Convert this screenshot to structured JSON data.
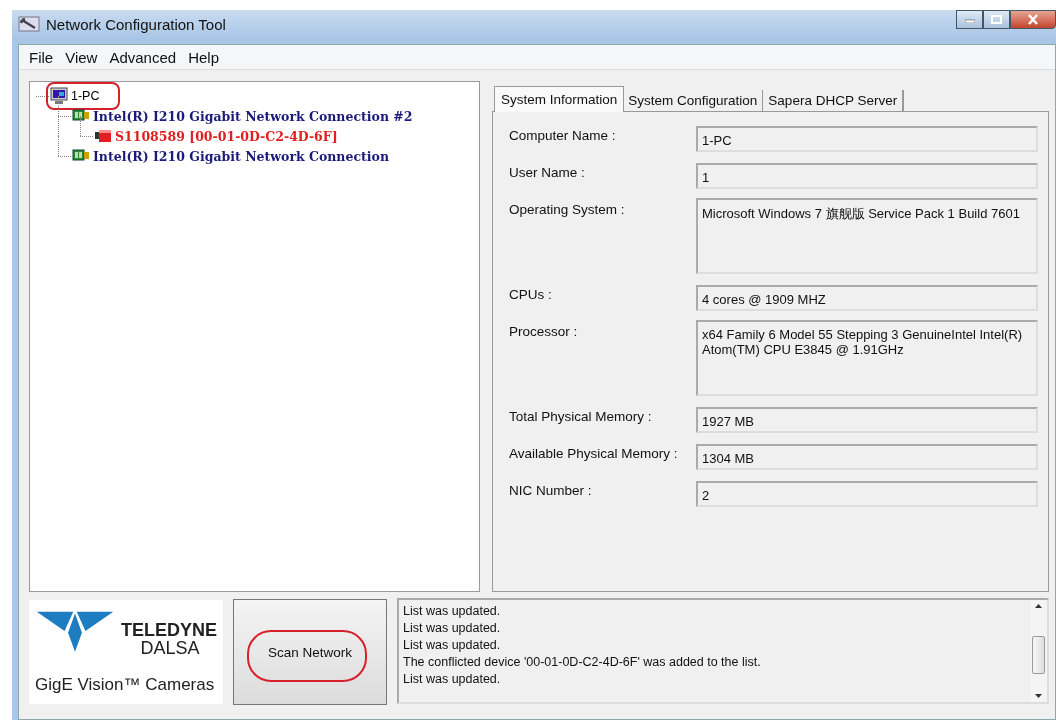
{
  "window": {
    "title": "Network Configuration Tool"
  },
  "menu": [
    "File",
    "View",
    "Advanced",
    "Help"
  ],
  "tree": [
    {
      "label": "1-PC",
      "kind": "computer",
      "highlighted": true,
      "children": [
        {
          "label": "Intel(R) I210 Gigabit Network Connection #2",
          "kind": "adapter",
          "highlighted": false,
          "children": [
            {
              "label": "S1108589 [00-01-0D-C2-4D-6F]",
              "kind": "camera",
              "highlighted": false
            }
          ]
        },
        {
          "label": "Intel(R) I210 Gigabit Network Connection",
          "kind": "adapter",
          "highlighted": false
        }
      ]
    }
  ],
  "tabs": [
    {
      "label": "System Information",
      "selected": true
    },
    {
      "label": "System Configuration",
      "selected": false
    },
    {
      "label": "Sapera DHCP Server",
      "selected": false
    }
  ],
  "fields": [
    {
      "label": "Computer Name :",
      "value": "1-PC",
      "kind": "single"
    },
    {
      "label": "User Name :",
      "value": "1",
      "kind": "single"
    },
    {
      "label": "Operating System :",
      "value": "Microsoft Windows 7 旗舰版  Service Pack 1 Build 7601",
      "kind": "multiline"
    },
    {
      "label": "CPUs :",
      "value": "4 cores @ 1909 MHZ",
      "kind": "single"
    },
    {
      "label": "Processor :",
      "value": "x64 Family 6 Model 55 Stepping 3 GenuineIntel Intel(R) Atom(TM) CPU  E3845  @ 1.91GHz",
      "kind": "multiline"
    },
    {
      "label": "Total Physical Memory :",
      "value": "1927 MB",
      "kind": "single"
    },
    {
      "label": "Available Physical Memory :",
      "value": "1304 MB",
      "kind": "single"
    },
    {
      "label": "NIC Number :",
      "value": "2",
      "kind": "single"
    }
  ],
  "logo": {
    "brand": "TELEDYNE",
    "sub": "DALSA",
    "caption": "GigE Vision™ Cameras"
  },
  "scan_button": {
    "label": "Scan Network",
    "highlighted": true
  },
  "log": [
    "List was updated.",
    "List was updated.",
    "List was updated.",
    "The conflicted device '00-01-0D-C2-4D-6F' was added to the list.",
    "List was updated."
  ]
}
